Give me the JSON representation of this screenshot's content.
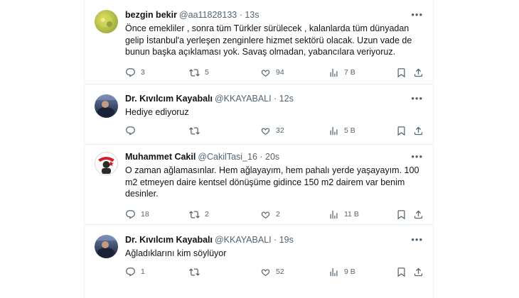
{
  "tweets": [
    {
      "name": "bezgin bekir",
      "handle": "@aa11828133 · 13s",
      "text": "Önce emekliler , sonra tüm Türkler sürülecek , kalanlarda tüm dünyadan gelip İstanbul'a yerleşen zenginlere hizmet sektörü olacak. Uzun vade de bunun başka açıklaması yok. Savaş olmadan, yabancılara veriyoruz.",
      "replies": "3",
      "retweets": "5",
      "likes": "94",
      "views": "7 B"
    },
    {
      "name": "Dr. Kıvılcım Kayabalı",
      "handle": "@KKAYABALI · 12s",
      "text": "Hediye ediyoruz",
      "replies": "",
      "retweets": "",
      "likes": "32",
      "views": "5 B"
    },
    {
      "name": "Muhammet Cakil",
      "handle": "@CakilTasi_16 · 20s",
      "text": "O zaman ağlamasınlar. Hem ağlayayım, hem pahalı yerde yaşayayım. 100 m2 etmeyen daire kentsel dönüşüme gidince 150 m2 dairem var benim desinler.",
      "replies": "18",
      "retweets": "2",
      "likes": "2",
      "views": "11 B"
    },
    {
      "name": "Dr. Kıvılcım Kayabalı",
      "handle": "@KKAYABALI · 19s",
      "text": "Ağladıklarını kim söylüyor",
      "replies": "1",
      "retweets": "",
      "likes": "52",
      "views": "9 B"
    }
  ],
  "icons": {
    "more": "more-horizontal-icon",
    "reply": "reply-icon",
    "retweet": "retweet-icon",
    "like": "heart-icon",
    "views": "views-chart-icon",
    "bookmark": "bookmark-icon",
    "share": "share-icon"
  }
}
